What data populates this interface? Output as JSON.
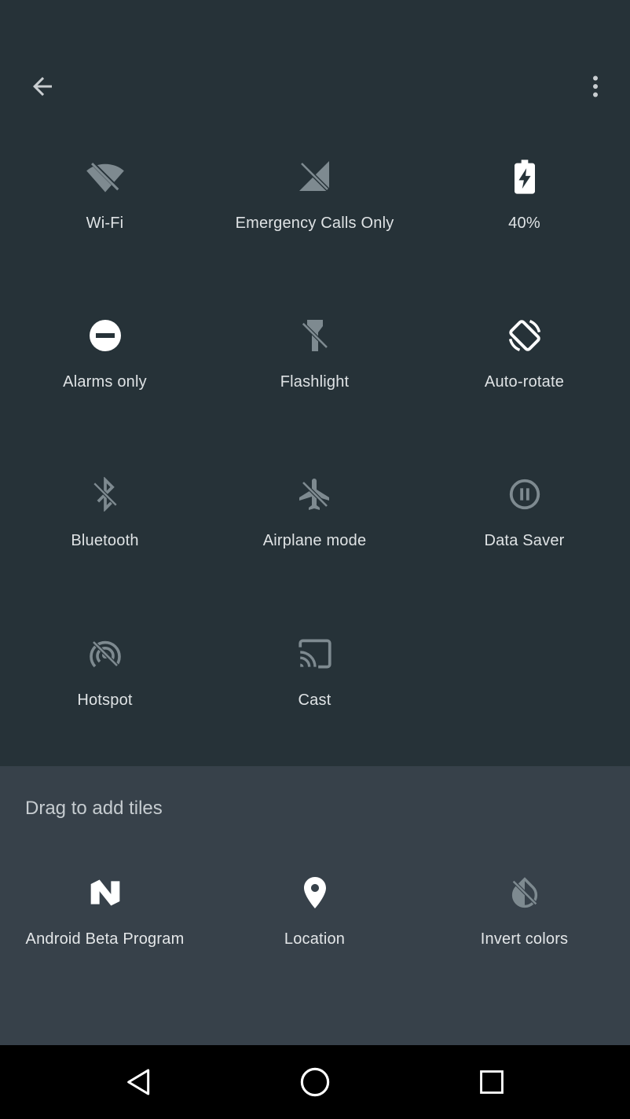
{
  "qs_tiles": [
    {
      "label": "Wi-Fi",
      "icon": "wifi-off-icon"
    },
    {
      "label": "Emergency Calls Only",
      "icon": "signal-off-icon"
    },
    {
      "label": "40%",
      "icon": "battery-charging-icon"
    },
    {
      "label": "Alarms only",
      "icon": "do-not-disturb-icon"
    },
    {
      "label": "Flashlight",
      "icon": "flashlight-off-icon"
    },
    {
      "label": "Auto-rotate",
      "icon": "auto-rotate-icon"
    },
    {
      "label": "Bluetooth",
      "icon": "bluetooth-off-icon"
    },
    {
      "label": "Airplane mode",
      "icon": "airplane-off-icon"
    },
    {
      "label": "Data Saver",
      "icon": "data-saver-icon"
    },
    {
      "label": "Hotspot",
      "icon": "hotspot-off-icon"
    },
    {
      "label": "Cast",
      "icon": "cast-icon"
    }
  ],
  "add_section": {
    "title": "Drag to add tiles",
    "tiles": [
      {
        "label": "Android Beta Program",
        "icon": "android-beta-icon"
      },
      {
        "label": "Location",
        "icon": "location-pin-icon"
      },
      {
        "label": "Invert colors",
        "icon": "invert-colors-off-icon"
      }
    ]
  },
  "colors": {
    "panel": "#263238",
    "add_panel": "#37414a",
    "icon_active": "#ffffff",
    "icon_inactive": "#7e8a90"
  }
}
